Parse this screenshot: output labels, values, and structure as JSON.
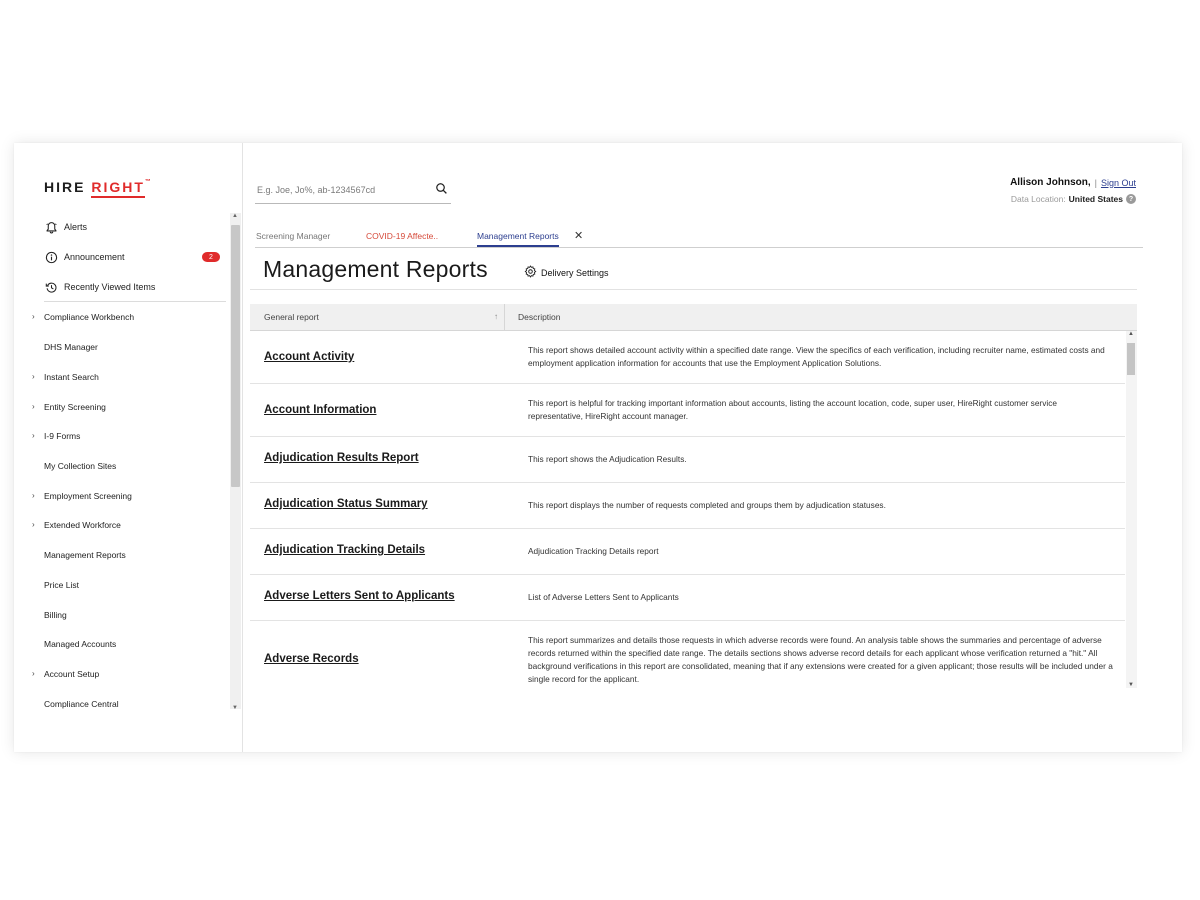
{
  "brand": {
    "logo_left": "HIRE",
    "logo_right": "RIGHT",
    "logo_mark": "™"
  },
  "sidebar": {
    "top_items": [
      {
        "label": "Alerts",
        "icon": "bell-icon"
      },
      {
        "label": "Announcement",
        "icon": "info-icon",
        "badge": "2"
      },
      {
        "label": "Recently Viewed Items",
        "icon": "history-icon"
      }
    ],
    "nav_items": [
      {
        "label": "Compliance Workbench",
        "expandable": true
      },
      {
        "label": "DHS Manager",
        "expandable": false
      },
      {
        "label": "Instant Search",
        "expandable": true
      },
      {
        "label": "Entity Screening",
        "expandable": true
      },
      {
        "label": "I-9 Forms",
        "expandable": true
      },
      {
        "label": "My Collection Sites",
        "expandable": false
      },
      {
        "label": "Employment Screening",
        "expandable": true
      },
      {
        "label": "Extended Workforce",
        "expandable": true
      },
      {
        "label": "Management Reports",
        "expandable": false
      },
      {
        "label": "Price List",
        "expandable": false
      },
      {
        "label": "Billing",
        "expandable": false
      },
      {
        "label": "Managed Accounts",
        "expandable": false
      },
      {
        "label": "Account Setup",
        "expandable": true
      },
      {
        "label": "Compliance Central",
        "expandable": false
      }
    ],
    "caret": "›"
  },
  "search": {
    "placeholder": "E.g. Joe, Jo%, ab-1234567cd",
    "value": ""
  },
  "user": {
    "name": "Allison Johnson,",
    "separator": "|",
    "sign_out": "Sign Out",
    "location_label": "Data Location:",
    "location_value": "United States",
    "help": "?"
  },
  "tabs": [
    {
      "label": "Screening Manager",
      "active": false
    },
    {
      "label": "COVID-19 Affecte..",
      "active": false
    },
    {
      "label": "Management Reports",
      "active": true
    }
  ],
  "tab_close": "✕",
  "page": {
    "title": "Management Reports",
    "delivery_settings": "Delivery Settings"
  },
  "table": {
    "columns": [
      "General report",
      "Description"
    ],
    "sort_indicator": "↑",
    "rows": [
      {
        "title": "Account Activity",
        "description": "This report shows detailed account activity within a specified date range. View the specifics of each verification, including recruiter name, estimated costs and employment application information for accounts that use the Employment Application Solutions."
      },
      {
        "title": "Account Information",
        "description": "This report is helpful for tracking important information about accounts, listing the account location, code, super user, HireRight customer service representative, HireRight account manager."
      },
      {
        "title": "Adjudication Results Report",
        "description": "This report shows the Adjudication Results."
      },
      {
        "title": "Adjudication Status Summary",
        "description": "This report displays the number of requests completed and groups them by adjudication statuses."
      },
      {
        "title": "Adjudication Tracking Details",
        "description": "Adjudication Tracking Details report"
      },
      {
        "title": "Adverse Letters Sent to Applicants",
        "description": "List of Adverse Letters Sent to Applicants"
      },
      {
        "title": "Adverse Records",
        "description": "This report summarizes and details those requests in which adverse records were found. An analysis table shows the summaries and percentage of adverse records returned within the specified date range. The details sections shows adverse record details for each applicant whose verification returned a \"hit.\" All background verifications in this report are consolidated, meaning that if any extensions were created for a given applicant; those results will be included under a single record for the applicant."
      }
    ]
  },
  "colors": {
    "brand_red": "#e02b2b",
    "link_blue": "#2c3e8f",
    "tab_red": "#d64a3a"
  }
}
